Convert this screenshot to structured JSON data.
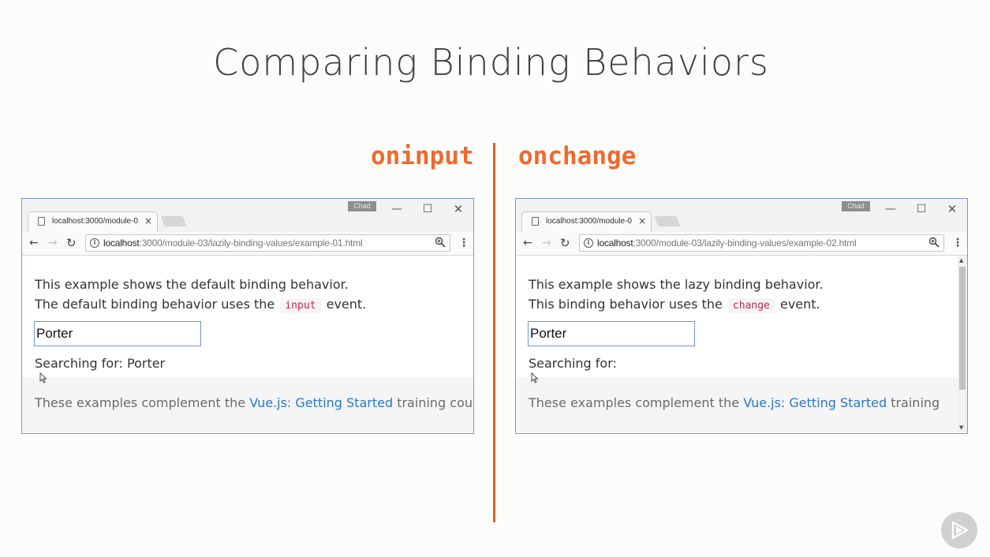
{
  "slide": {
    "title": "Comparing Binding Behaviors",
    "left_label": "oninput",
    "right_label": "onchange"
  },
  "colors": {
    "accent": "#ee6a2f",
    "divider": "#ea5e2a",
    "link": "#2a78c6",
    "code": "#c7254e",
    "window_border": "#6f9bd0"
  },
  "left_window": {
    "user_badge": "Chad",
    "tab_title": "localhost:3000/module-0",
    "url_host": "localhost",
    "url_path": ":3000/module-03/lazily-binding-values/example-01.html",
    "controls": {
      "minimize": "—",
      "maximize": "☐",
      "close": "✕"
    },
    "line1": "This example shows the default binding behavior.",
    "line2_before": "The default binding behavior uses the",
    "line2_code": "input",
    "line2_after": "event.",
    "input_value": "Porter",
    "searching_text": "Searching for: Porter",
    "footer_before": "These examples complement the",
    "footer_link": "Vue.js: Getting Started",
    "footer_after": "training course."
  },
  "right_window": {
    "user_badge": "Chad",
    "tab_title": "localhost:3000/module-0",
    "url_host": "localhost",
    "url_path": ":3000/module-03/lazily-binding-values/example-02.html",
    "controls": {
      "minimize": "—",
      "maximize": "☐",
      "close": "✕"
    },
    "line1": "This example shows the lazy binding behavior.",
    "line2_before": "This binding behavior uses the",
    "line2_code": "change",
    "line2_after": "event.",
    "input_value": "Porter",
    "searching_text": "Searching for:",
    "footer_before": "These examples complement the",
    "footer_link": "Vue.js: Getting Started",
    "footer_after": "training"
  },
  "icons": {
    "back": "arrow-left-icon",
    "forward": "arrow-right-icon",
    "reload": "reload-icon",
    "info": "info-icon",
    "zoom": "zoom-icon",
    "menu": "menu-icon",
    "play": "play-icon"
  }
}
